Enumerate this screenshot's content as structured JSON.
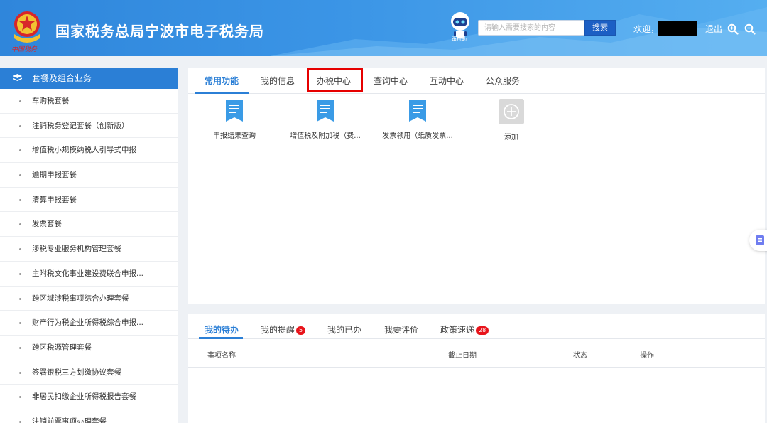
{
  "header": {
    "title": "国家税务总局宁波市电子税务局",
    "emblem_script": "中国税务",
    "robot_label": "甬税助",
    "search_placeholder": "请输入需要搜索的内容",
    "search_button": "搜索",
    "welcome": "欢迎，",
    "logout": "退出",
    "icons": [
      "zoom-in-icon",
      "zoom-out-icon"
    ]
  },
  "sidebar": {
    "title": "套餐及组合业务",
    "items": [
      "车购税套餐",
      "注销税务登记套餐（创新版）",
      "增值税小规模纳税人引导式申报",
      "逾期申报套餐",
      "清算申报套餐",
      "发票套餐",
      "涉税专业服务机构管理套餐",
      "主附税文化事业建设费联合申报...",
      "跨区域涉税事项综合办理套餐",
      "财产行为税企业所得税综合申报...",
      "跨区税源管理套餐",
      "签署银税三方划缴协议套餐",
      "非居民扣缴企业所得税报告套餐",
      "注销前票事项办理套餐"
    ]
  },
  "top_tabs": [
    "常用功能",
    "我的信息",
    "办税中心",
    "查询中心",
    "互动中心",
    "公众服务"
  ],
  "functions": [
    {
      "label": "申报结果查询"
    },
    {
      "label": "增值税及附加税（费..."
    },
    {
      "label": "发票领用（纸质发票..."
    },
    {
      "label": "添加"
    }
  ],
  "bottom_tabs": [
    {
      "label": "我的待办",
      "badge": ""
    },
    {
      "label": "我的提醒",
      "badge": "5"
    },
    {
      "label": "我的已办",
      "badge": ""
    },
    {
      "label": "我要评价",
      "badge": ""
    },
    {
      "label": "政策速递",
      "badge": "28"
    }
  ],
  "table_headers": [
    "事项名称",
    "截止日期",
    "状态",
    "操作"
  ],
  "colors": {
    "accent": "#2b7fd6",
    "highlight": "#e60000",
    "badge": "#e8141b"
  }
}
